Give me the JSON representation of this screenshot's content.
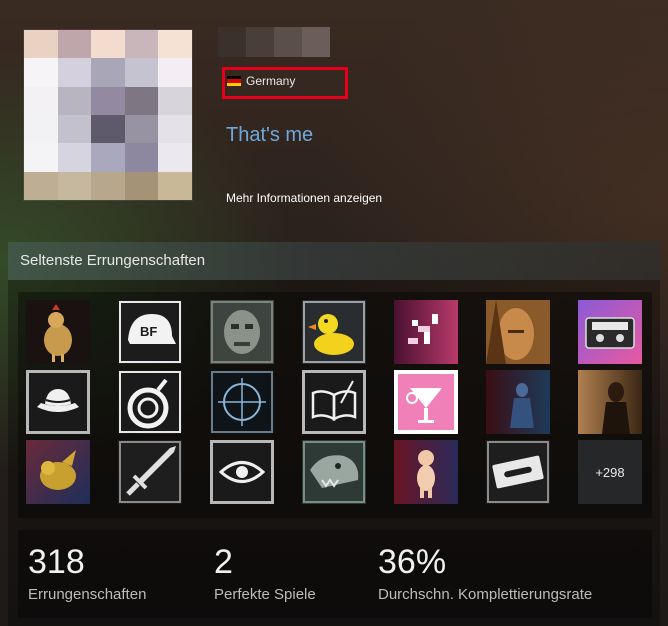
{
  "profile": {
    "country": "Germany",
    "summary": "That's me",
    "more_info": "Mehr Informationen anzeigen"
  },
  "showcase": {
    "title": "Seltenste Errungenschaften",
    "more_count": "+298",
    "icons": [
      "chicken-icon",
      "bf-cap-icon",
      "stone-face-icon",
      "rubber-duck-icon",
      "pixel-creature-icon",
      "portrait-icon",
      "cassette-icon",
      "fedora-hat-icon",
      "bomb-icon",
      "crosshair-icon",
      "book-quill-icon",
      "cocktail-icon",
      "blue-figure-icon",
      "dark-figure-icon",
      "gold-creature-icon",
      "sword-icon",
      "eye-icon",
      "monster-head-icon",
      "baby-doll-icon",
      "razor-blade-icon"
    ]
  },
  "stats": [
    {
      "value": "318",
      "label": "Errungenschaften"
    },
    {
      "value": "2",
      "label": "Perfekte Spiele"
    },
    {
      "value": "36%",
      "label": "Durchschn. Komplettierungsrate"
    }
  ]
}
